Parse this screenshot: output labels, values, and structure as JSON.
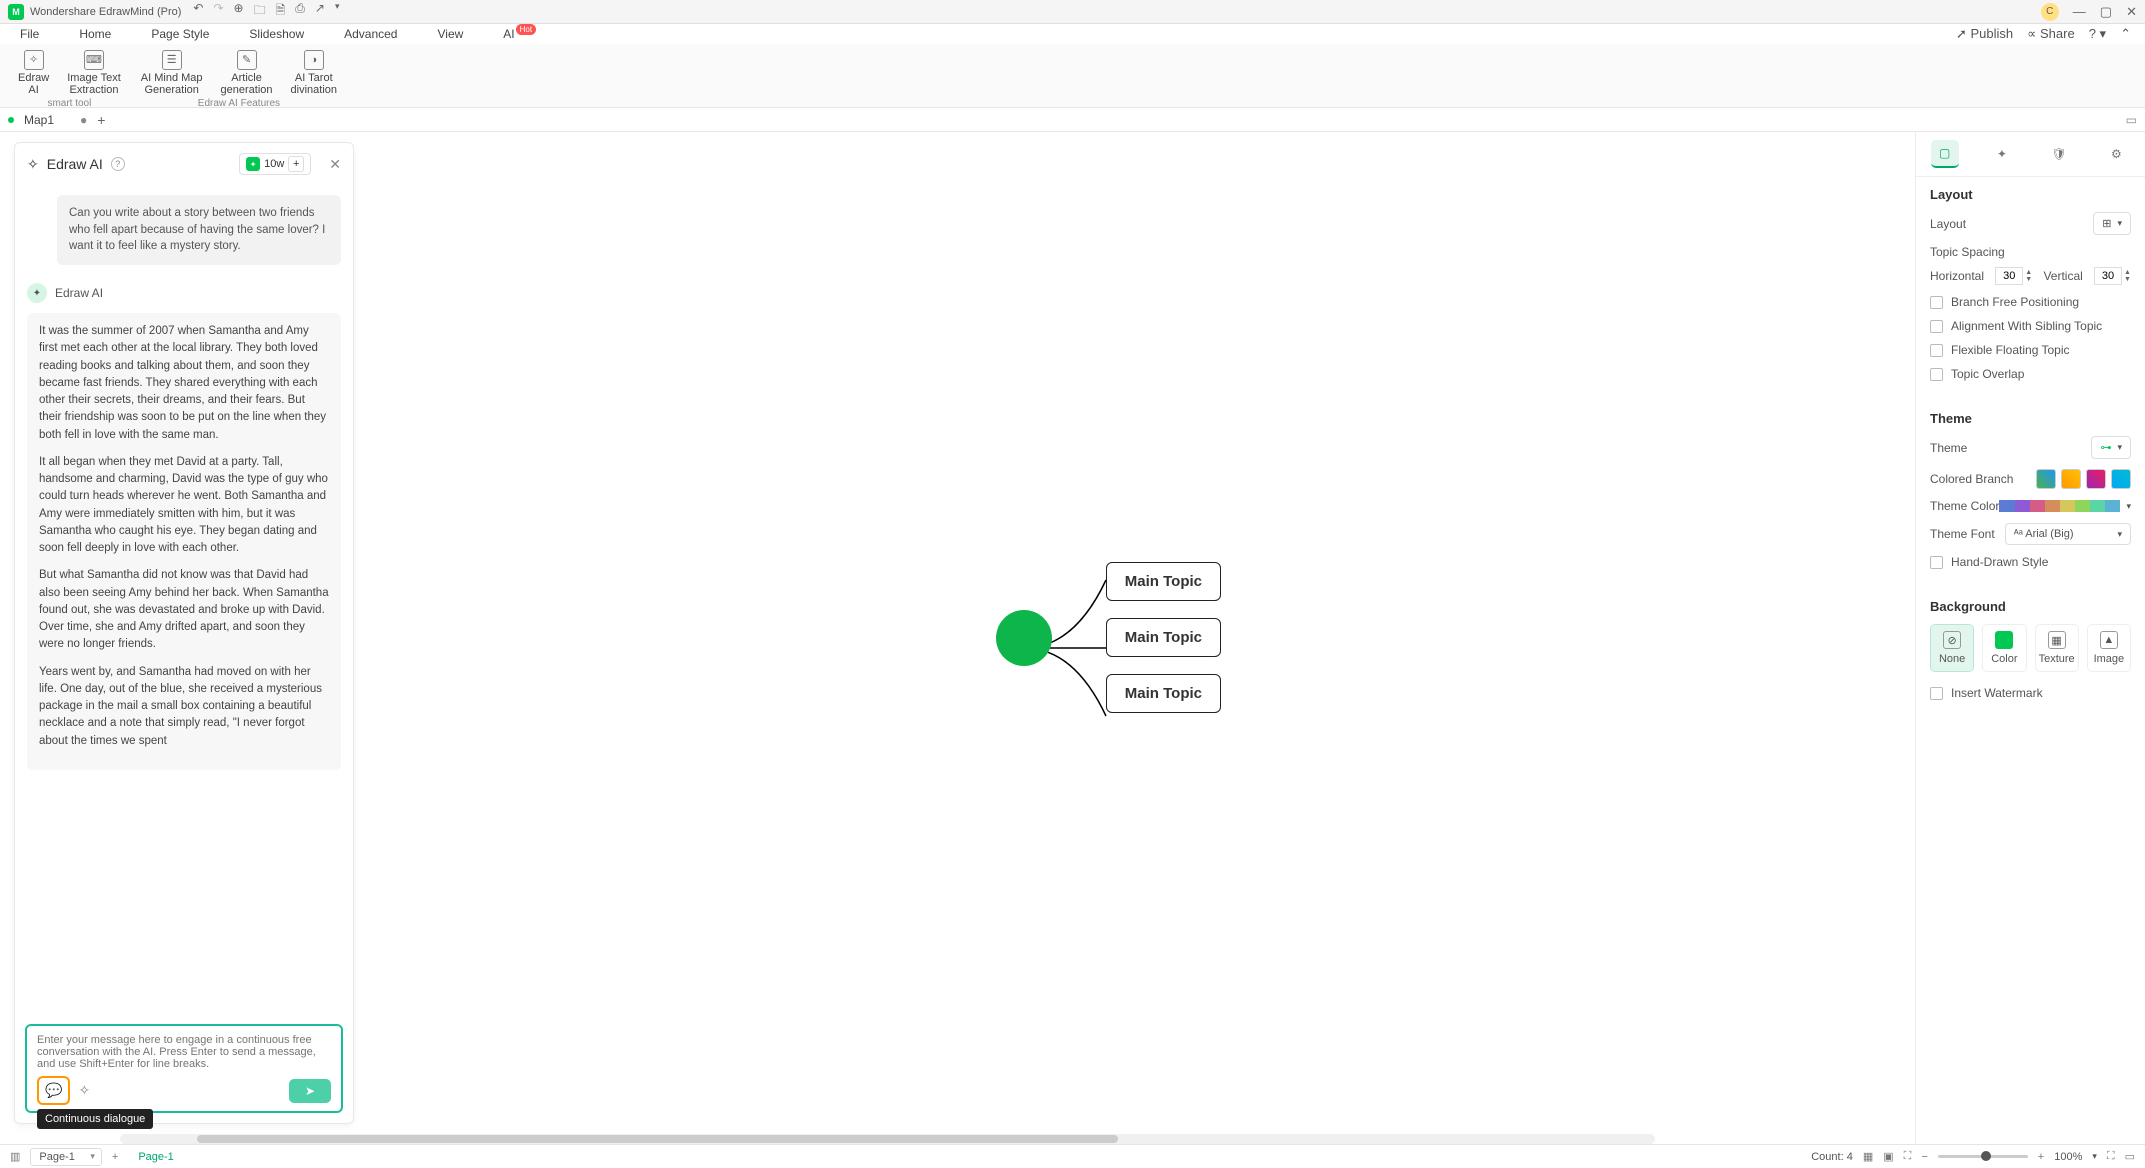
{
  "titlebar": {
    "title": "Wondershare EdrawMind (Pro)",
    "avatar": "C"
  },
  "menubar": {
    "items": [
      "File",
      "Home",
      "Page Style",
      "Slideshow",
      "Advanced",
      "View",
      "AI"
    ],
    "hot": "Hot",
    "right": {
      "publish": "Publish",
      "share": "Share"
    }
  },
  "ribbon": {
    "group1_caption": "smart tool",
    "group2_caption": "Edraw AI Features",
    "btns": {
      "edraw_ai": "Edraw\nAI",
      "image_text": "Image Text\nExtraction",
      "mindmap_gen": "AI Mind Map\nGeneration",
      "article_gen": "Article\ngeneration",
      "tarot": "AI Tarot\ndivination"
    }
  },
  "doctabs": {
    "tab1": "Map1"
  },
  "ai_panel": {
    "title": "Edraw AI",
    "credits": "10w",
    "user_msg": "Can you write about a story between two friends who fell apart because of having the same lover? I want it to feel like a mystery story.",
    "ai_label": "Edraw AI",
    "ai_p1": "It was the summer of 2007 when Samantha and Amy first met each other at the local library. They both loved reading books and talking about them, and soon they became fast friends. They shared everything with each other  their secrets, their dreams, and their fears. But their friendship was soon to be put on the line when they both fell in love with the same man.",
    "ai_p2": "It all began when they met David at a party. Tall, handsome and charming, David was the type of guy who could turn heads wherever he went. Both Samantha and Amy were immediately smitten with him, but it was Samantha who caught his eye. They began dating and soon fell deeply in love with each other.",
    "ai_p3": "But what Samantha did not know was that David had also been seeing Amy behind her back. When Samantha found out, she was devastated and broke up with David. Over time, she and Amy drifted apart, and soon they were no longer friends.",
    "ai_p4": "Years went by, and Samantha had moved on with her life. One day, out of the blue, she received a mysterious package in the mail  a small box containing a beautiful necklace and a note that simply read, \"I never forgot about the times we spent",
    "placeholder": "Enter your message here to engage in a continuous free conversation with the AI. Press Enter to send a message, and use Shift+Enter for line breaks.",
    "tooltip": "Continuous dialogue"
  },
  "mindmap": {
    "t1": "Main Topic",
    "t2": "Main Topic",
    "t3": "Main Topic"
  },
  "right_panel": {
    "layout_h": "Layout",
    "layout_l": "Layout",
    "topic_spacing": "Topic Spacing",
    "horizontal": "Horizontal",
    "h_val": "30",
    "vertical": "Vertical",
    "v_val": "30",
    "chk1": "Branch Free Positioning",
    "chk2": "Alignment With Sibling Topic",
    "chk3": "Flexible Floating Topic",
    "chk4": "Topic Overlap",
    "theme_h": "Theme",
    "theme_l": "Theme",
    "colored_branch": "Colored Branch",
    "theme_color": "Theme Color",
    "theme_font": "Theme Font",
    "theme_font_val": "Arial (Big)",
    "hand_drawn": "Hand-Drawn Style",
    "background_h": "Background",
    "bg_none": "None",
    "bg_color": "Color",
    "bg_texture": "Texture",
    "bg_image": "Image",
    "insert_wm": "Insert Watermark"
  },
  "statusbar": {
    "page_sel": "Page-1",
    "page_tab": "Page-1",
    "count": "Count: 4",
    "zoom": "100%"
  }
}
